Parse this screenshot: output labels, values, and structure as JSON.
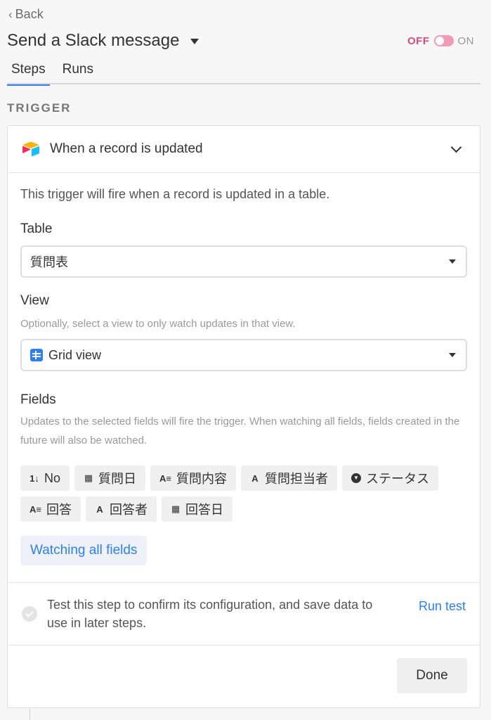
{
  "header": {
    "back_label": "Back",
    "title": "Send a Slack message",
    "toggle": {
      "off_label": "OFF",
      "on_label": "ON",
      "state": "off"
    }
  },
  "tabs": [
    {
      "label": "Steps",
      "active": true
    },
    {
      "label": "Runs",
      "active": false
    }
  ],
  "section_label": "TRIGGER",
  "trigger": {
    "title": "When a record is updated",
    "description": "This trigger will fire when a record is updated in a table.",
    "table": {
      "label": "Table",
      "value": "質問表"
    },
    "view": {
      "label": "View",
      "hint": "Optionally, select a view to only watch updates in that view.",
      "value": "Grid view"
    },
    "fields": {
      "label": "Fields",
      "hint": "Updates to the selected fields will fire the trigger. When watching all fields, fields created in the future will also be watched.",
      "chips": [
        {
          "icon": "autonumber-icon",
          "glyph": "1↓",
          "label": "No"
        },
        {
          "icon": "date-icon",
          "glyph": "▦",
          "label": "質問日"
        },
        {
          "icon": "long-text-icon",
          "glyph": "A≡",
          "label": "質問内容"
        },
        {
          "icon": "single-line-text-icon",
          "glyph": "A",
          "label": "質問担当者"
        },
        {
          "icon": "single-select-icon",
          "glyph": "▼",
          "label": "ステータス"
        },
        {
          "icon": "long-text-icon",
          "glyph": "A≡",
          "label": "回答"
        },
        {
          "icon": "single-line-text-icon",
          "glyph": "A",
          "label": "回答者"
        },
        {
          "icon": "date-icon",
          "glyph": "▦",
          "label": "回答日"
        }
      ],
      "watch_button": "Watching all fields"
    },
    "test": {
      "text": "Test this step to confirm its configuration, and save data to use in later steps.",
      "run_label": "Run test"
    },
    "done_label": "Done"
  },
  "colors": {
    "accent": "#2d7ff9",
    "toggle_off": "#e0497a",
    "background": "#f7f7f7"
  }
}
